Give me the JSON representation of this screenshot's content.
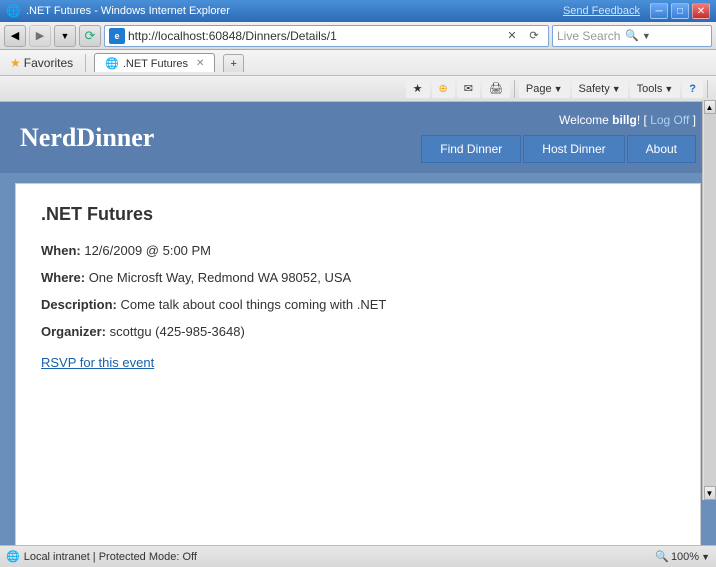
{
  "titlebar": {
    "title": ".NET Futures - Windows Internet Explorer",
    "send_feedback": "Send Feedback",
    "minimize": "─",
    "maximize": "□",
    "close": "✕"
  },
  "addressbar": {
    "url": "http://localhost:60848/Dinners/Details/1",
    "live_search_placeholder": "Live Search",
    "refresh_icon": "⟳",
    "stop_icon": "✕",
    "back_icon": "◀",
    "forward_icon": "▶",
    "ie_icon": "e"
  },
  "favoritesbar": {
    "favorites_label": "Favorites",
    "tab_label": ".NET Futures"
  },
  "commandbar": {
    "page_label": "Page",
    "safety_label": "Safety",
    "tools_label": "Tools",
    "help_icon": "?"
  },
  "page": {
    "site_title": "NerdDinner",
    "welcome_text": "Welcome ",
    "username": "billg",
    "logoff_label": "Log Off",
    "nav": {
      "find_dinner": "Find Dinner",
      "host_dinner": "Host Dinner",
      "about": "About"
    },
    "dinner": {
      "title": ".NET Futures",
      "when_label": "When:",
      "when_value": "12/6/2009 @ 5:00 PM",
      "where_label": "Where:",
      "where_value": "One Microsft Way, Redmond WA 98052, USA",
      "description_label": "Description:",
      "description_value": "Come talk about cool things coming with .NET",
      "organizer_label": "Organizer:",
      "organizer_value": "scottgu (425-985-3648)",
      "rsvp_label": "RSVP for this event"
    }
  },
  "statusbar": {
    "zone": "Local intranet | Protected Mode: Off",
    "zoom": "100%",
    "globe_icon": "🌐",
    "zoom_icon": "🔍",
    "dropdown_icon": "▼"
  }
}
